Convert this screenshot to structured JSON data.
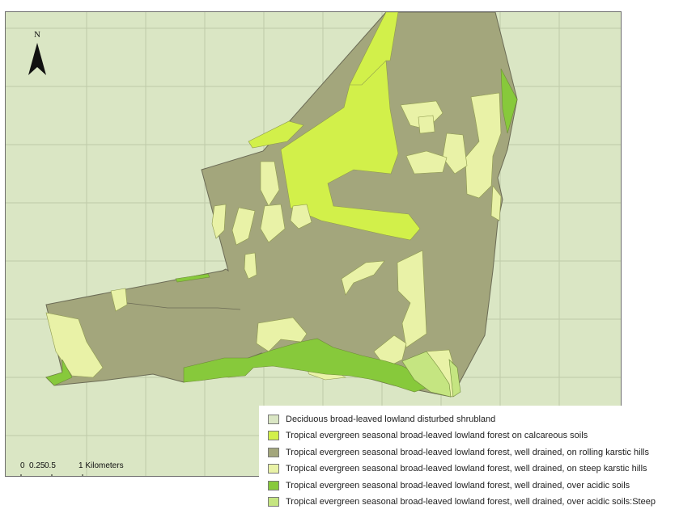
{
  "map": {
    "north_label": "N",
    "scale_bar": {
      "labels": [
        "0",
        "0.25",
        "0.5",
        "1 Kilometers"
      ],
      "units": "Kilometers"
    },
    "colors": {
      "background": "#dae6c4",
      "grid": "#bfcaa9",
      "shrubland": "#dae6c4",
      "calcareous": "#d2f04a",
      "rolling": "#a3a67c",
      "steep": "#e9f2a7",
      "acidic": "#87c93b",
      "acidic_steep": "#c5e581"
    }
  },
  "legend": {
    "items": [
      {
        "label": "Deciduous broad-leaved lowland disturbed shrubland",
        "color": "#dae6c4"
      },
      {
        "label": "Tropical evergreen seasonal broad-leaved lowland forest on calcareous soils",
        "color": "#d2f04a"
      },
      {
        "label": "Tropical evergreen seasonal broad-leaved lowland forest, well drained, on rolling karstic hills",
        "color": "#a3a67c"
      },
      {
        "label": "Tropical evergreen seasonal broad-leaved lowland forest, well drained, on steep karstic hills",
        "color": "#e9f2a7"
      },
      {
        "label": "Tropical evergreen seasonal broad-leaved lowland forest, well drained, over acidic soils",
        "color": "#87c93b"
      },
      {
        "label": "Tropical evergreen seasonal broad-leaved lowland forest, well drained, over acidic soils:Steep",
        "color": "#c5e581"
      }
    ]
  }
}
